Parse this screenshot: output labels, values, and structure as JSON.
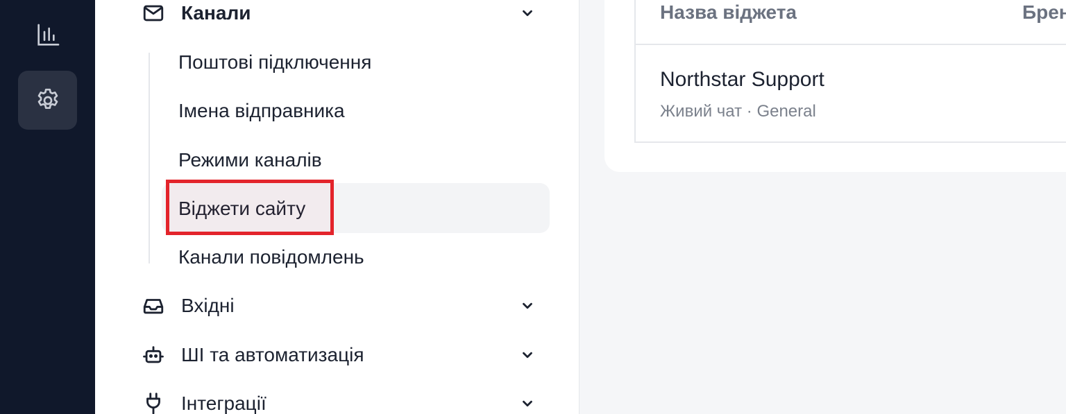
{
  "rail": {
    "items": [
      {
        "icon": "bar-chart-icon",
        "active": false
      },
      {
        "icon": "gear-icon",
        "active": true
      }
    ]
  },
  "sidebar": {
    "groups": [
      {
        "label": "Канали",
        "icon": "mail-icon",
        "expanded": true
      },
      {
        "label": "Вхідні",
        "icon": "inbox-icon",
        "expanded": false
      },
      {
        "label": "ШІ та автоматизація",
        "icon": "bot-icon",
        "expanded": false
      },
      {
        "label": "Інтеграції",
        "icon": "plug-icon",
        "expanded": false
      }
    ],
    "channel_items": [
      {
        "label": "Поштові підключення"
      },
      {
        "label": "Імена відправника"
      },
      {
        "label": "Режими каналів"
      },
      {
        "label": "Віджети сайту",
        "active": true
      },
      {
        "label": "Канали повідомлень"
      }
    ]
  },
  "table": {
    "headers": [
      "Назва віджета",
      "Брен"
    ],
    "rows": [
      {
        "name": "Northstar Support",
        "meta": "Живий чат · General"
      }
    ]
  },
  "colors": {
    "rail_bg": "#10182b",
    "highlight": "#e3242b"
  }
}
